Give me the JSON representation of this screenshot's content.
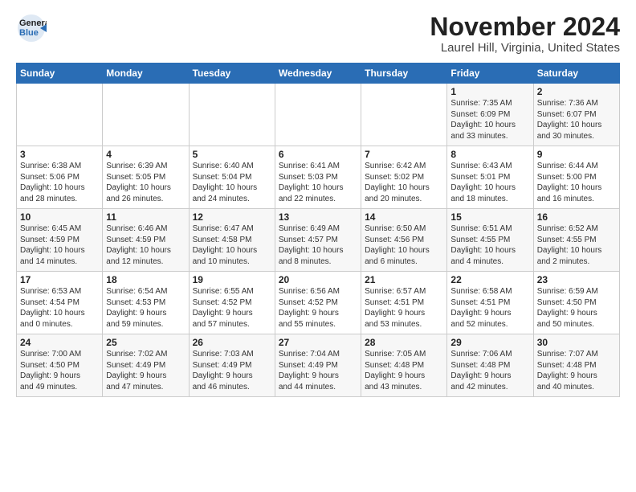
{
  "logo": {
    "line1": "General",
    "line2": "Blue"
  },
  "title": "November 2024",
  "subtitle": "Laurel Hill, Virginia, United States",
  "weekdays": [
    "Sunday",
    "Monday",
    "Tuesday",
    "Wednesday",
    "Thursday",
    "Friday",
    "Saturday"
  ],
  "weeks": [
    [
      {
        "num": "",
        "info": ""
      },
      {
        "num": "",
        "info": ""
      },
      {
        "num": "",
        "info": ""
      },
      {
        "num": "",
        "info": ""
      },
      {
        "num": "",
        "info": ""
      },
      {
        "num": "1",
        "info": "Sunrise: 7:35 AM\nSunset: 6:09 PM\nDaylight: 10 hours\nand 33 minutes."
      },
      {
        "num": "2",
        "info": "Sunrise: 7:36 AM\nSunset: 6:07 PM\nDaylight: 10 hours\nand 30 minutes."
      }
    ],
    [
      {
        "num": "3",
        "info": "Sunrise: 6:38 AM\nSunset: 5:06 PM\nDaylight: 10 hours\nand 28 minutes."
      },
      {
        "num": "4",
        "info": "Sunrise: 6:39 AM\nSunset: 5:05 PM\nDaylight: 10 hours\nand 26 minutes."
      },
      {
        "num": "5",
        "info": "Sunrise: 6:40 AM\nSunset: 5:04 PM\nDaylight: 10 hours\nand 24 minutes."
      },
      {
        "num": "6",
        "info": "Sunrise: 6:41 AM\nSunset: 5:03 PM\nDaylight: 10 hours\nand 22 minutes."
      },
      {
        "num": "7",
        "info": "Sunrise: 6:42 AM\nSunset: 5:02 PM\nDaylight: 10 hours\nand 20 minutes."
      },
      {
        "num": "8",
        "info": "Sunrise: 6:43 AM\nSunset: 5:01 PM\nDaylight: 10 hours\nand 18 minutes."
      },
      {
        "num": "9",
        "info": "Sunrise: 6:44 AM\nSunset: 5:00 PM\nDaylight: 10 hours\nand 16 minutes."
      }
    ],
    [
      {
        "num": "10",
        "info": "Sunrise: 6:45 AM\nSunset: 4:59 PM\nDaylight: 10 hours\nand 14 minutes."
      },
      {
        "num": "11",
        "info": "Sunrise: 6:46 AM\nSunset: 4:59 PM\nDaylight: 10 hours\nand 12 minutes."
      },
      {
        "num": "12",
        "info": "Sunrise: 6:47 AM\nSunset: 4:58 PM\nDaylight: 10 hours\nand 10 minutes."
      },
      {
        "num": "13",
        "info": "Sunrise: 6:49 AM\nSunset: 4:57 PM\nDaylight: 10 hours\nand 8 minutes."
      },
      {
        "num": "14",
        "info": "Sunrise: 6:50 AM\nSunset: 4:56 PM\nDaylight: 10 hours\nand 6 minutes."
      },
      {
        "num": "15",
        "info": "Sunrise: 6:51 AM\nSunset: 4:55 PM\nDaylight: 10 hours\nand 4 minutes."
      },
      {
        "num": "16",
        "info": "Sunrise: 6:52 AM\nSunset: 4:55 PM\nDaylight: 10 hours\nand 2 minutes."
      }
    ],
    [
      {
        "num": "17",
        "info": "Sunrise: 6:53 AM\nSunset: 4:54 PM\nDaylight: 10 hours\nand 0 minutes."
      },
      {
        "num": "18",
        "info": "Sunrise: 6:54 AM\nSunset: 4:53 PM\nDaylight: 9 hours\nand 59 minutes."
      },
      {
        "num": "19",
        "info": "Sunrise: 6:55 AM\nSunset: 4:52 PM\nDaylight: 9 hours\nand 57 minutes."
      },
      {
        "num": "20",
        "info": "Sunrise: 6:56 AM\nSunset: 4:52 PM\nDaylight: 9 hours\nand 55 minutes."
      },
      {
        "num": "21",
        "info": "Sunrise: 6:57 AM\nSunset: 4:51 PM\nDaylight: 9 hours\nand 53 minutes."
      },
      {
        "num": "22",
        "info": "Sunrise: 6:58 AM\nSunset: 4:51 PM\nDaylight: 9 hours\nand 52 minutes."
      },
      {
        "num": "23",
        "info": "Sunrise: 6:59 AM\nSunset: 4:50 PM\nDaylight: 9 hours\nand 50 minutes."
      }
    ],
    [
      {
        "num": "24",
        "info": "Sunrise: 7:00 AM\nSunset: 4:50 PM\nDaylight: 9 hours\nand 49 minutes."
      },
      {
        "num": "25",
        "info": "Sunrise: 7:02 AM\nSunset: 4:49 PM\nDaylight: 9 hours\nand 47 minutes."
      },
      {
        "num": "26",
        "info": "Sunrise: 7:03 AM\nSunset: 4:49 PM\nDaylight: 9 hours\nand 46 minutes."
      },
      {
        "num": "27",
        "info": "Sunrise: 7:04 AM\nSunset: 4:49 PM\nDaylight: 9 hours\nand 44 minutes."
      },
      {
        "num": "28",
        "info": "Sunrise: 7:05 AM\nSunset: 4:48 PM\nDaylight: 9 hours\nand 43 minutes."
      },
      {
        "num": "29",
        "info": "Sunrise: 7:06 AM\nSunset: 4:48 PM\nDaylight: 9 hours\nand 42 minutes."
      },
      {
        "num": "30",
        "info": "Sunrise: 7:07 AM\nSunset: 4:48 PM\nDaylight: 9 hours\nand 40 minutes."
      }
    ]
  ]
}
